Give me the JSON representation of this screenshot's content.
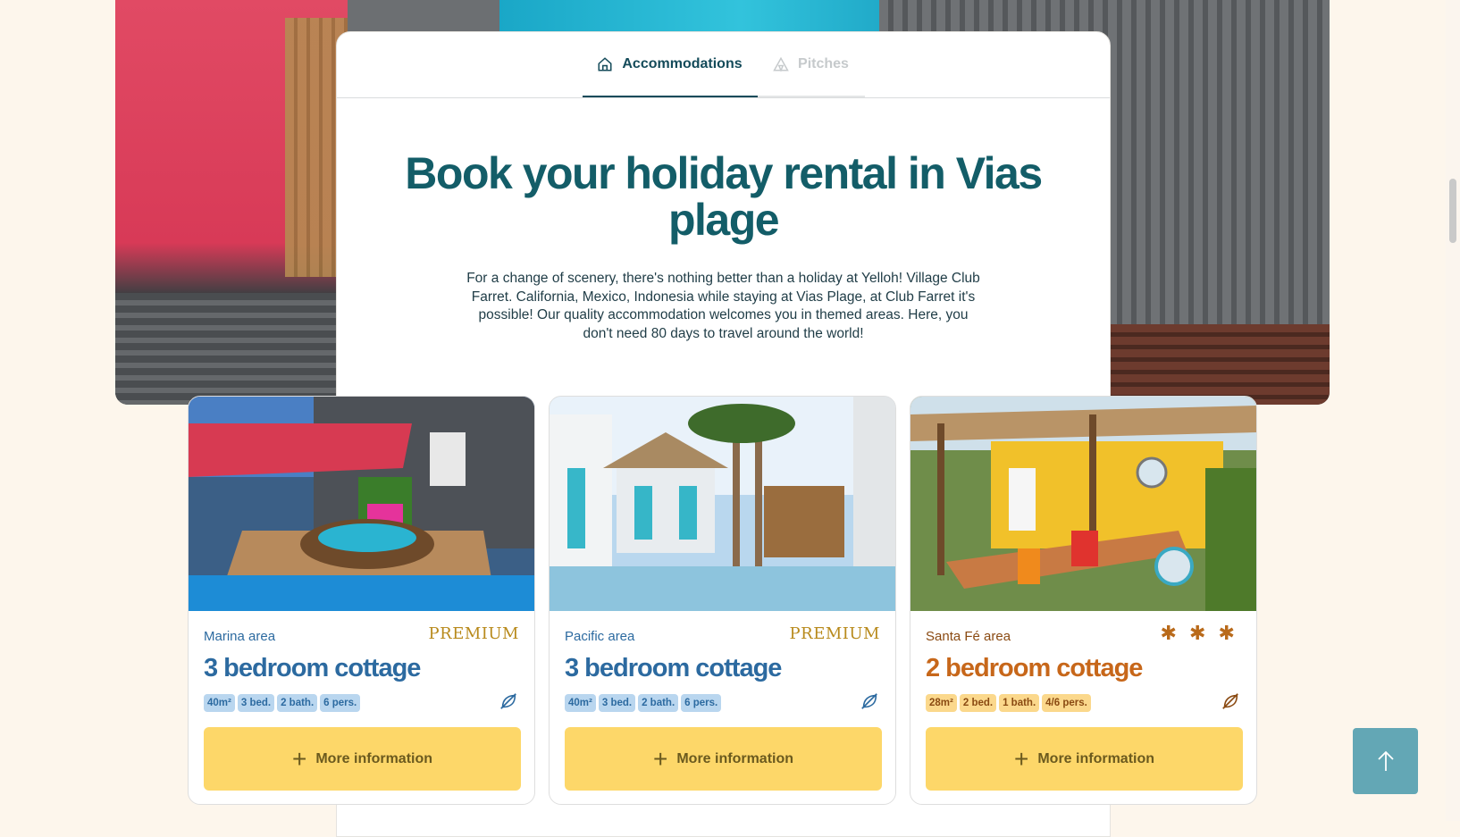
{
  "tabs": [
    {
      "label": "Accommodations",
      "icon": "house-icon",
      "active": true
    },
    {
      "label": "Pitches",
      "icon": "tent-icon",
      "active": false
    }
  ],
  "title": "Book your holiday rental in Vias plage",
  "intro": "For a change of scenery, there's nothing better than a holiday at Yelloh! Village Club Farret. California, Mexico, Indonesia while staying at Vias Plage, at Club Farret it's possible! Our quality accommodation welcomes you in themed areas. Here, you don't need 80 days to travel around the world!",
  "cards": [
    {
      "area": "Marina area",
      "rating": "PREMIUM",
      "title": "3 bedroom cottage",
      "tags": [
        "40m²",
        "3 bed.",
        "2 bath.",
        "6 pers."
      ],
      "button": "More information",
      "theme": "blue"
    },
    {
      "area": "Pacific area",
      "rating": "PREMIUM",
      "title": "3 bedroom cottage",
      "tags": [
        "40m²",
        "3 bed.",
        "2 bath.",
        "6 pers."
      ],
      "button": "More information",
      "theme": "blue"
    },
    {
      "area": "Santa Fé area",
      "rating": "✱ ✱ ✱",
      "title": "2 bedroom cottage",
      "tags": [
        "28m²",
        "2 bed.",
        "1 bath.",
        "4/6 pers."
      ],
      "button": "More information",
      "theme": "orange"
    }
  ],
  "icons": {
    "eco": "leaf-crossed-icon",
    "back_to_top": "arrow-up-icon"
  },
  "colors": {
    "primary": "#135d68",
    "yellow_button": "#fdd769",
    "blue_accent": "#2c6aa0",
    "orange_accent": "#c7671a",
    "back_to_top": "#63a7b5"
  }
}
